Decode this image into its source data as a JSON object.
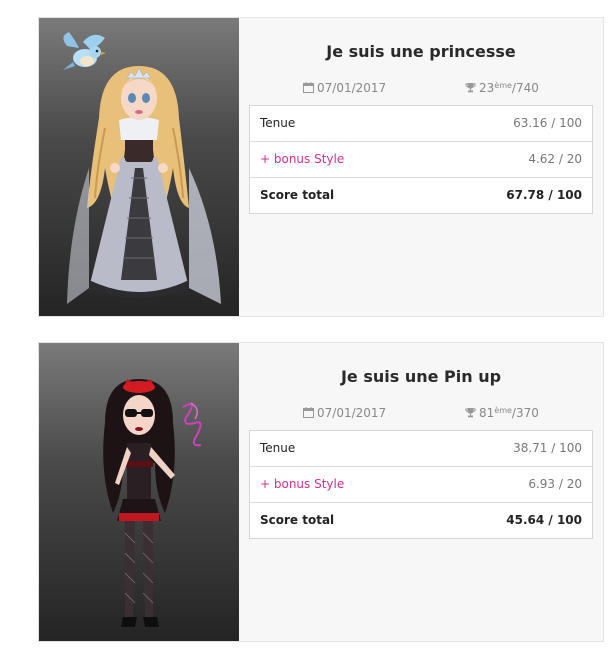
{
  "entries": [
    {
      "title": "Je suis une princesse",
      "date": "07/01/2017",
      "rank": "23",
      "rank_suffix": "ème",
      "rank_total": "/740",
      "rows": [
        {
          "label": "Tenue",
          "value": "63.16 / 100"
        },
        {
          "label": "+ bonus Style",
          "value": "4.62 / 20"
        },
        {
          "label": "Score total",
          "value": "67.78 / 100"
        }
      ]
    },
    {
      "title": "Je suis une Pin up",
      "date": "07/01/2017",
      "rank": "81",
      "rank_suffix": "ème",
      "rank_total": "/370",
      "rows": [
        {
          "label": "Tenue",
          "value": "38.71 / 100"
        },
        {
          "label": "+ bonus Style",
          "value": "6.93 / 20"
        },
        {
          "label": "Score total",
          "value": "45.64 / 100"
        }
      ]
    }
  ],
  "icons": {
    "date": "calendar-icon",
    "rank": "trophy-icon"
  },
  "colors": {
    "bonus": "#d2308f",
    "panel_top": "#7a7a7a",
    "panel_bottom": "#242424"
  }
}
